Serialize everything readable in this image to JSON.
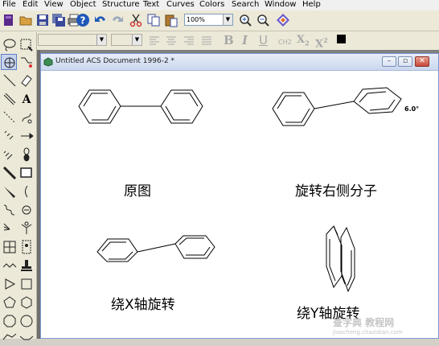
{
  "menubar": {
    "items": [
      "File",
      "Edit",
      "View",
      "Object",
      "Structure",
      "Text",
      "Curves",
      "Colors",
      "Search",
      "Window",
      "Help"
    ]
  },
  "toolbar": {
    "zoom": "100%",
    "format": {
      "bold": "B",
      "italic": "I",
      "underline": "U",
      "ch2": "CH2",
      "subscript": "X",
      "subscript_sub": "2",
      "superscript": "X",
      "superscript_sup": "2"
    }
  },
  "document": {
    "title": "Untitled ACS Document 1996-2 *",
    "labels": {
      "original": "原图",
      "rotate_right_molecule": "旋转右侧分子",
      "rotate_x": "绕X轴旋转",
      "rotate_y": "绕Y轴旋转",
      "angle": "6.0°"
    }
  },
  "watermark": {
    "main": "查字典 教程网",
    "sub": "jiaocheng.chazidian.com"
  },
  "icons": [
    "new-icon",
    "open-icon",
    "save-icon",
    "save-all-icon",
    "print-icon",
    "help-icon",
    "undo-icon",
    "redo-icon",
    "cut-icon",
    "copy-icon",
    "paste-icon",
    "zoom-in-icon",
    "zoom-out-icon",
    "color-icon"
  ]
}
